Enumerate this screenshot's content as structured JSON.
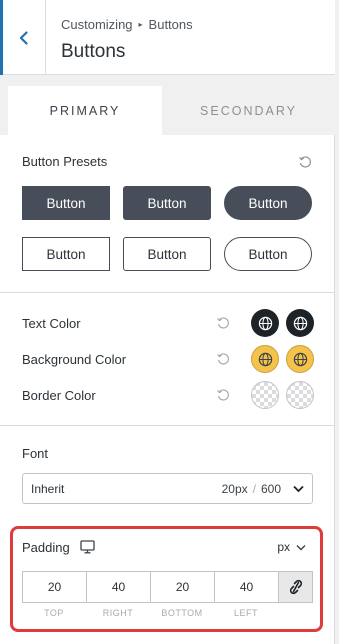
{
  "header": {
    "breadcrumb_root": "Customizing",
    "breadcrumb_separator": "▸",
    "breadcrumb_current": "Buttons",
    "title": "Buttons"
  },
  "tabs": [
    {
      "label": "PRIMARY",
      "active": true
    },
    {
      "label": "SECONDARY",
      "active": false
    }
  ],
  "presets": {
    "label": "Button Presets",
    "buttons": [
      {
        "label": "Button",
        "style": "solid-square"
      },
      {
        "label": "Button",
        "style": "solid-rounded"
      },
      {
        "label": "Button",
        "style": "solid-pill"
      },
      {
        "label": "Button",
        "style": "outline-square"
      },
      {
        "label": "Button",
        "style": "outline-rounded"
      },
      {
        "label": "Button",
        "style": "outline-pill"
      }
    ]
  },
  "colors": {
    "text_color_label": "Text Color",
    "background_color_label": "Background Color",
    "border_color_label": "Border Color",
    "text_swatch_color": "#1d2327",
    "background_swatch_color": "#f5c24b",
    "icons": [
      "reset-icon",
      "globe-icon",
      "checker-transparent"
    ]
  },
  "font": {
    "label": "Font",
    "family": "Inherit",
    "size": "20px",
    "separator": "/",
    "weight": "600"
  },
  "padding": {
    "label": "Padding",
    "unit": "px",
    "top": "20",
    "right": "40",
    "bottom": "20",
    "left": "40",
    "labels": [
      "TOP",
      "RIGHT",
      "BOTTOM",
      "LEFT"
    ],
    "highlight_color": "#e03b3b"
  }
}
